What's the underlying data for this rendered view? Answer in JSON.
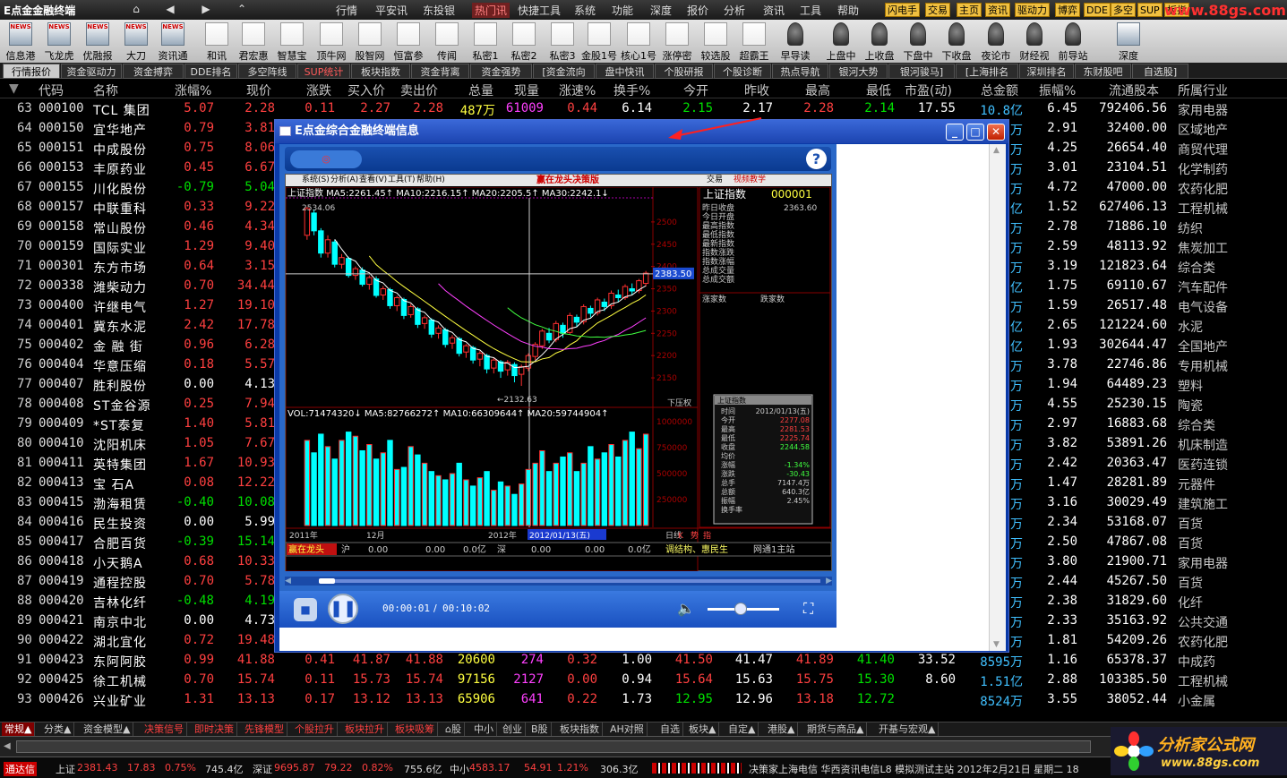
{
  "app_title": "E点金金融终端",
  "nav_buttons": [
    "⌂",
    "◀",
    "▶",
    "⌃"
  ],
  "menus": [
    "行情",
    "平安讯",
    "东投银",
    "热门讯",
    "快捷工具",
    "系统",
    "功能",
    "深度",
    "报价",
    "分析",
    "资讯",
    "工具",
    "帮助"
  ],
  "active_menu": "热门讯",
  "top_tags": [
    "闪电手",
    "交易",
    "主页",
    "资讯",
    "驱动力",
    "博弈",
    "DDE",
    "多空",
    "SUP",
    "板指"
  ],
  "watermark_top": "www.88gs.com",
  "toolbar": [
    "信息港",
    "飞龙虎",
    "优融报",
    "大刀",
    "资讯通",
    "和讯",
    "君宏惠",
    "智慧宝",
    "顶牛网",
    "股智网",
    "恒富参",
    "传闻",
    "私密1",
    "私密2",
    "私密3",
    "金股1号",
    "核心1号",
    "涨停密",
    "较选股",
    "超霸王",
    "早导读",
    "上盘中",
    "上收盘",
    "下盘中",
    "下收盘",
    "夜论市",
    "财经视",
    "前导站",
    "深度"
  ],
  "tabs": [
    "行情报价",
    "资金驱动力",
    "资金搏弈",
    "DDE排名",
    "多空阵线",
    "SUP统计",
    "板块指数",
    "资金背离",
    "资金强势",
    "[资金流向",
    "盘中快讯",
    "个股研报",
    "个股诊断",
    "热点导航",
    "银河大势",
    "银河骏马]",
    "[上海排名",
    "深圳排名",
    "东财股吧",
    "自选股]"
  ],
  "columns": [
    "代码",
    "名称",
    "涨幅%",
    "现价",
    "涨跌",
    "买入价",
    "卖出价",
    "总量",
    "现量",
    "涨速%",
    "换手%",
    "今开",
    "昨收",
    "最高",
    "最低",
    "市盈(动)",
    "总金额",
    "振幅%",
    "流通股本",
    "所属行业"
  ],
  "rows": [
    {
      "n": "63",
      "code": "000100",
      "name": "TCL 集团",
      "pct": "5.07",
      "price": "2.28",
      "chg": "0.11",
      "bid": "2.27",
      "ask": "2.28",
      "vol": "487万",
      "cur": "61009",
      "spd": "0.44",
      "turn": "6.14",
      "open": "2.15",
      "prev": "2.17",
      "high": "2.28",
      "low": "2.14",
      "pe": "17.55",
      "amt": "10.8亿",
      "amp": "6.45",
      "float": "792406.56",
      "ind": "家用电器"
    },
    {
      "n": "64",
      "code": "000150",
      "name": "宜华地产",
      "pct": "0.79",
      "price": "3.81",
      "amt": "万",
      "amp": "2.91",
      "float": "32400.00",
      "ind": "区域地产"
    },
    {
      "n": "65",
      "code": "000151",
      "name": "中成股份",
      "pct": "0.75",
      "price": "8.06",
      "amt": "万",
      "amp": "4.25",
      "float": "26654.40",
      "ind": "商贸代理"
    },
    {
      "n": "66",
      "code": "000153",
      "name": "丰原药业",
      "pct": "0.45",
      "price": "6.67",
      "amt": "万",
      "amp": "3.01",
      "float": "23104.51",
      "ind": "化学制药"
    },
    {
      "n": "67",
      "code": "000155",
      "name": "川化股份",
      "pct": "-0.79",
      "price": "5.04",
      "amt": "万",
      "amp": "4.72",
      "float": "47000.00",
      "ind": "农药化肥"
    },
    {
      "n": "68",
      "code": "000157",
      "name": "中联重科",
      "pct": "0.33",
      "price": "9.22",
      "amt": "亿",
      "amp": "1.52",
      "float": "627406.13",
      "ind": "工程机械"
    },
    {
      "n": "69",
      "code": "000158",
      "name": "常山股份",
      "pct": "0.46",
      "price": "4.34",
      "amt": "万",
      "amp": "2.78",
      "float": "71886.10",
      "ind": "纺织"
    },
    {
      "n": "70",
      "code": "000159",
      "name": "国际实业",
      "pct": "1.29",
      "price": "9.40",
      "amt": "万",
      "amp": "2.59",
      "float": "48113.92",
      "ind": "焦炭加工"
    },
    {
      "n": "71",
      "code": "000301",
      "name": "东方市场",
      "pct": "0.64",
      "price": "3.15",
      "amt": "万",
      "amp": "3.19",
      "float": "121823.64",
      "ind": "综合类"
    },
    {
      "n": "72",
      "code": "000338",
      "name": "潍柴动力",
      "pct": "0.70",
      "price": "34.44",
      "amt": "亿",
      "amp": "1.75",
      "float": "69110.67",
      "ind": "汽车配件"
    },
    {
      "n": "73",
      "code": "000400",
      "name": "许继电气",
      "pct": "1.27",
      "price": "19.10",
      "amt": "万",
      "amp": "1.59",
      "float": "26517.48",
      "ind": "电气设备"
    },
    {
      "n": "74",
      "code": "000401",
      "name": "冀东水泥",
      "pct": "2.42",
      "price": "17.78",
      "amt": "亿",
      "amp": "2.65",
      "float": "121224.60",
      "ind": "水泥"
    },
    {
      "n": "75",
      "code": "000402",
      "name": "金 融 街",
      "pct": "0.96",
      "price": "6.28",
      "amt": "亿",
      "amp": "1.93",
      "float": "302644.47",
      "ind": "全国地产"
    },
    {
      "n": "76",
      "code": "000404",
      "name": "华意压缩",
      "pct": "0.18",
      "price": "5.57",
      "amt": "万",
      "amp": "3.78",
      "float": "22746.86",
      "ind": "专用机械"
    },
    {
      "n": "77",
      "code": "000407",
      "name": "胜利股份",
      "pct": "0.00",
      "price": "4.13",
      "amt": "万",
      "amp": "1.94",
      "float": "64489.23",
      "ind": "塑料"
    },
    {
      "n": "78",
      "code": "000408",
      "name": "ST金谷源",
      "pct": "0.25",
      "price": "7.94",
      "amt": "万",
      "amp": "4.55",
      "float": "25230.15",
      "ind": "陶瓷"
    },
    {
      "n": "79",
      "code": "000409",
      "name": "*ST泰复",
      "pct": "1.40",
      "price": "5.81",
      "amt": "万",
      "amp": "2.97",
      "float": "16883.68",
      "ind": "综合类"
    },
    {
      "n": "80",
      "code": "000410",
      "name": "沈阳机床",
      "pct": "1.05",
      "price": "7.67",
      "amt": "万",
      "amp": "3.82",
      "float": "53891.26",
      "ind": "机床制造"
    },
    {
      "n": "81",
      "code": "000411",
      "name": "英特集团",
      "pct": "1.67",
      "price": "10.93",
      "amt": "万",
      "amp": "2.42",
      "float": "20363.47",
      "ind": "医药连锁"
    },
    {
      "n": "82",
      "code": "000413",
      "name": "宝  石A",
      "pct": "0.08",
      "price": "12.22",
      "amt": "万",
      "amp": "1.47",
      "float": "28281.89",
      "ind": "元器件"
    },
    {
      "n": "83",
      "code": "000415",
      "name": "渤海租赁",
      "pct": "-0.40",
      "price": "10.08",
      "amt": "万",
      "amp": "3.16",
      "float": "30029.49",
      "ind": "建筑施工"
    },
    {
      "n": "84",
      "code": "000416",
      "name": "民生投资",
      "pct": "0.00",
      "price": "5.99",
      "amt": "万",
      "amp": "2.34",
      "float": "53168.07",
      "ind": "百货"
    },
    {
      "n": "85",
      "code": "000417",
      "name": "合肥百货",
      "pct": "-0.39",
      "price": "15.14",
      "amt": "万",
      "amp": "2.50",
      "float": "47867.08",
      "ind": "百货"
    },
    {
      "n": "86",
      "code": "000418",
      "name": "小天鹅A",
      "pct": "0.68",
      "price": "10.33",
      "amt": "万",
      "amp": "3.80",
      "float": "21900.71",
      "ind": "家用电器"
    },
    {
      "n": "87",
      "code": "000419",
      "name": "通程控股",
      "pct": "0.70",
      "price": "5.78",
      "amt": "万",
      "amp": "2.44",
      "float": "45267.50",
      "ind": "百货"
    },
    {
      "n": "88",
      "code": "000420",
      "name": "吉林化纤",
      "pct": "-0.48",
      "price": "4.19",
      "amt": "万",
      "amp": "2.38",
      "float": "31829.60",
      "ind": "化纤"
    },
    {
      "n": "89",
      "code": "000421",
      "name": "南京中北",
      "pct": "0.00",
      "price": "4.73",
      "amt": "万",
      "amp": "2.33",
      "float": "35163.92",
      "ind": "公共交通"
    },
    {
      "n": "90",
      "code": "000422",
      "name": "湖北宜化",
      "pct": "0.72",
      "price": "19.48",
      "amt": "万",
      "amp": "1.81",
      "float": "54209.26",
      "ind": "农药化肥"
    },
    {
      "n": "91",
      "code": "000423",
      "name": "东阿阿胶",
      "pct": "0.99",
      "price": "41.88",
      "chg": "0.41",
      "bid": "41.87",
      "ask": "41.88",
      "vol": "20600",
      "cur": "274",
      "spd": "0.32",
      "turn": "1.00",
      "open": "41.50",
      "prev": "41.47",
      "high": "41.89",
      "low": "41.40",
      "pe": "33.52",
      "amt": "8595万",
      "amp": "1.16",
      "float": "65378.37",
      "ind": "中成药"
    },
    {
      "n": "92",
      "code": "000425",
      "name": "徐工机械",
      "pct": "0.70",
      "price": "15.74",
      "chg": "0.11",
      "bid": "15.73",
      "ask": "15.74",
      "vol": "97156",
      "cur": "2127",
      "spd": "0.00",
      "turn": "0.94",
      "open": "15.64",
      "prev": "15.63",
      "high": "15.75",
      "low": "15.30",
      "pe": "8.60",
      "amt": "1.51亿",
      "amp": "2.88",
      "float": "103385.50",
      "ind": "工程机械"
    },
    {
      "n": "93",
      "code": "000426",
      "name": "兴业矿业",
      "pct": "1.31",
      "price": "13.13",
      "chg": "0.17",
      "bid": "13.12",
      "ask": "13.13",
      "vol": "65906",
      "cur": "641",
      "spd": "0.22",
      "turn": "1.73",
      "open": "12.95",
      "prev": "12.96",
      "high": "13.18",
      "low": "12.72",
      "pe": "",
      "amt": "8524万",
      "amp": "3.55",
      "float": "38052.44",
      "ind": "小金属"
    }
  ],
  "bottom_tabs": [
    "常规▲",
    "分类▲",
    "资金模型▲",
    "决策信号",
    "即时决策",
    "先锋模型",
    "个股拉升",
    "板块拉升",
    "板块吸筹",
    "⌂股",
    "中小",
    "创业",
    "B股",
    "板块指数",
    "AH对照",
    "自选",
    "板块▲",
    "自定▲",
    "港股▲",
    "期货与商品▲",
    "开基与宏观▲"
  ],
  "status": {
    "brand": "通达信",
    "sh_label": "上证",
    "sh_val": "2381.43",
    "sh_chg": "17.83",
    "sh_pct": "0.75%",
    "sh_amt": "745.4亿",
    "sz_label": "深证",
    "sz_val": "9695.87",
    "sz_chg": "79.22",
    "sz_pct": "0.82%",
    "sz_amt": "755.6亿",
    "zx_label": "中小",
    "zx_val": "4583.17",
    "zx_chg": "54.91",
    "zx_pct": "1.21%",
    "zx_amt": "306.3亿",
    "right": "决策家上海电信 华西资讯电信L8 模拟测试主站 2012年2月21日 星期二 18"
  },
  "logo88": {
    "title": "分析家公式网",
    "url": "www.88gs.com"
  },
  "dialog": {
    "title": "E点金综合金融终端信息",
    "video": {
      "header_title": "赢在龙头决策版",
      "header_menus": [
        "系统(S)",
        "分析(A)",
        "查看(V)",
        "工具(T)",
        "帮助(H)"
      ],
      "header_right": [
        "交易",
        "视频教学"
      ],
      "ma_line": "上证指数 MA5:2261.45↑ MA10:2216.15↑ MA20:2205.5↑ MA30:2242.1↓",
      "peak_label": "2534.06",
      "low_label": "2132.63",
      "current_price": "2383.50",
      "yaxis": [
        "2500",
        "2450",
        "2400",
        "2350",
        "2300",
        "2250",
        "2200",
        "2150"
      ],
      "down_label": "下压权",
      "vol_line": "VOL:71474320↓ MA5:82766272↑ MA10:66309644↑ MA20:59744904↑",
      "vol_axis": [
        "1000000",
        "750000",
        "500000",
        "250000"
      ],
      "xaxis": [
        "2011年",
        "12月",
        "2012年",
        "2012/01/13(五)"
      ],
      "periods": [
        "日线",
        "K",
        "势",
        "指"
      ],
      "quote_strip": [
        "赢在龙头",
        "沪",
        "0.00",
        "0.00",
        "0.0亿",
        "深",
        "0.00",
        "0.00",
        "0.0亿",
        "调结构、惠民生",
        "网通1主站"
      ],
      "index_name": "上证指数",
      "index_code": "000001",
      "index_fields": [
        "昨日收盘",
        "今日开盘",
        "最高指数",
        "最低指数",
        "最新指数",
        "指数涨跌",
        "指数涨幅",
        "总成交量",
        "总成交额"
      ],
      "index_first_value": "2363.60",
      "rise_fall": [
        "涨家数",
        "跌家数"
      ],
      "popup_title": "上证指数",
      "popup_rows": [
        [
          "时间",
          "2012/01/13(五)"
        ],
        [
          "今开",
          "2277.08"
        ],
        [
          "最高",
          "2281.53"
        ],
        [
          "最低",
          "2225.74"
        ],
        [
          "收盘",
          "2244.58"
        ],
        [
          "均价",
          ""
        ],
        [
          "涨幅",
          "-1.34%"
        ],
        [
          "涨跌",
          "-30.43"
        ],
        [
          "总手",
          "7147.4万"
        ],
        [
          "总额",
          "640.3亿"
        ],
        [
          "振幅",
          "2.45%"
        ],
        [
          "换手率",
          ""
        ]
      ],
      "time_current": "00:00:01",
      "time_total": "00:10:02",
      "candles": [
        [
          2470,
          2530,
          2460,
          2534
        ],
        [
          2520,
          2480,
          2470,
          2528
        ],
        [
          2480,
          2430,
          2420,
          2486
        ],
        [
          2430,
          2460,
          2420,
          2470
        ],
        [
          2455,
          2405,
          2398,
          2460
        ],
        [
          2405,
          2420,
          2395,
          2428
        ],
        [
          2418,
          2380,
          2375,
          2422
        ],
        [
          2380,
          2395,
          2370,
          2400
        ],
        [
          2392,
          2360,
          2355,
          2398
        ],
        [
          2360,
          2375,
          2348,
          2380
        ],
        [
          2372,
          2335,
          2330,
          2378
        ],
        [
          2336,
          2350,
          2325,
          2356
        ],
        [
          2348,
          2312,
          2305,
          2352
        ],
        [
          2312,
          2330,
          2300,
          2334
        ],
        [
          2326,
          2290,
          2282,
          2330
        ],
        [
          2292,
          2310,
          2285,
          2316
        ],
        [
          2305,
          2270,
          2262,
          2309
        ],
        [
          2272,
          2285,
          2260,
          2290
        ],
        [
          2280,
          2248,
          2240,
          2284
        ],
        [
          2250,
          2262,
          2238,
          2268
        ],
        [
          2258,
          2225,
          2218,
          2262
        ],
        [
          2228,
          2240,
          2215,
          2246
        ],
        [
          2238,
          2205,
          2198,
          2242
        ],
        [
          2208,
          2222,
          2195,
          2226
        ],
        [
          2218,
          2190,
          2182,
          2222
        ],
        [
          2192,
          2205,
          2176,
          2210
        ],
        [
          2200,
          2170,
          2160,
          2204
        ],
        [
          2172,
          2190,
          2160,
          2196
        ],
        [
          2186,
          2165,
          2150,
          2190
        ],
        [
          2168,
          2185,
          2155,
          2190
        ],
        [
          2180,
          2155,
          2140,
          2185
        ],
        [
          2158,
          2175,
          2132,
          2180
        ],
        [
          2172,
          2200,
          2165,
          2205
        ],
        [
          2198,
          2225,
          2190,
          2230
        ],
        [
          2222,
          2255,
          2215,
          2260
        ],
        [
          2250,
          2235,
          2228,
          2262
        ],
        [
          2236,
          2272,
          2230,
          2278
        ],
        [
          2268,
          2250,
          2240,
          2274
        ],
        [
          2252,
          2290,
          2248,
          2296
        ],
        [
          2286,
          2275,
          2265,
          2292
        ],
        [
          2276,
          2310,
          2270,
          2315
        ],
        [
          2306,
          2295,
          2286,
          2312
        ],
        [
          2296,
          2325,
          2290,
          2330
        ],
        [
          2320,
          2310,
          2300,
          2328
        ],
        [
          2312,
          2340,
          2305,
          2346
        ],
        [
          2336,
          2330,
          2320,
          2348
        ],
        [
          2330,
          2355,
          2325,
          2360
        ],
        [
          2350,
          2345,
          2336,
          2362
        ],
        [
          2346,
          2368,
          2340,
          2372
        ],
        [
          2362,
          2385,
          2355,
          2390
        ]
      ],
      "volumes": [
        820,
        700,
        880,
        760,
        640,
        820,
        900,
        860,
        720,
        780,
        640,
        700,
        820,
        540,
        560,
        760,
        680,
        600,
        520,
        480,
        440,
        500,
        600,
        440,
        380,
        460,
        520,
        340,
        420,
        380,
        300,
        400,
        540,
        600,
        720,
        520,
        600,
        660,
        700,
        520,
        600,
        760,
        640,
        700,
        780,
        660,
        820,
        900,
        740,
        880
      ]
    }
  }
}
